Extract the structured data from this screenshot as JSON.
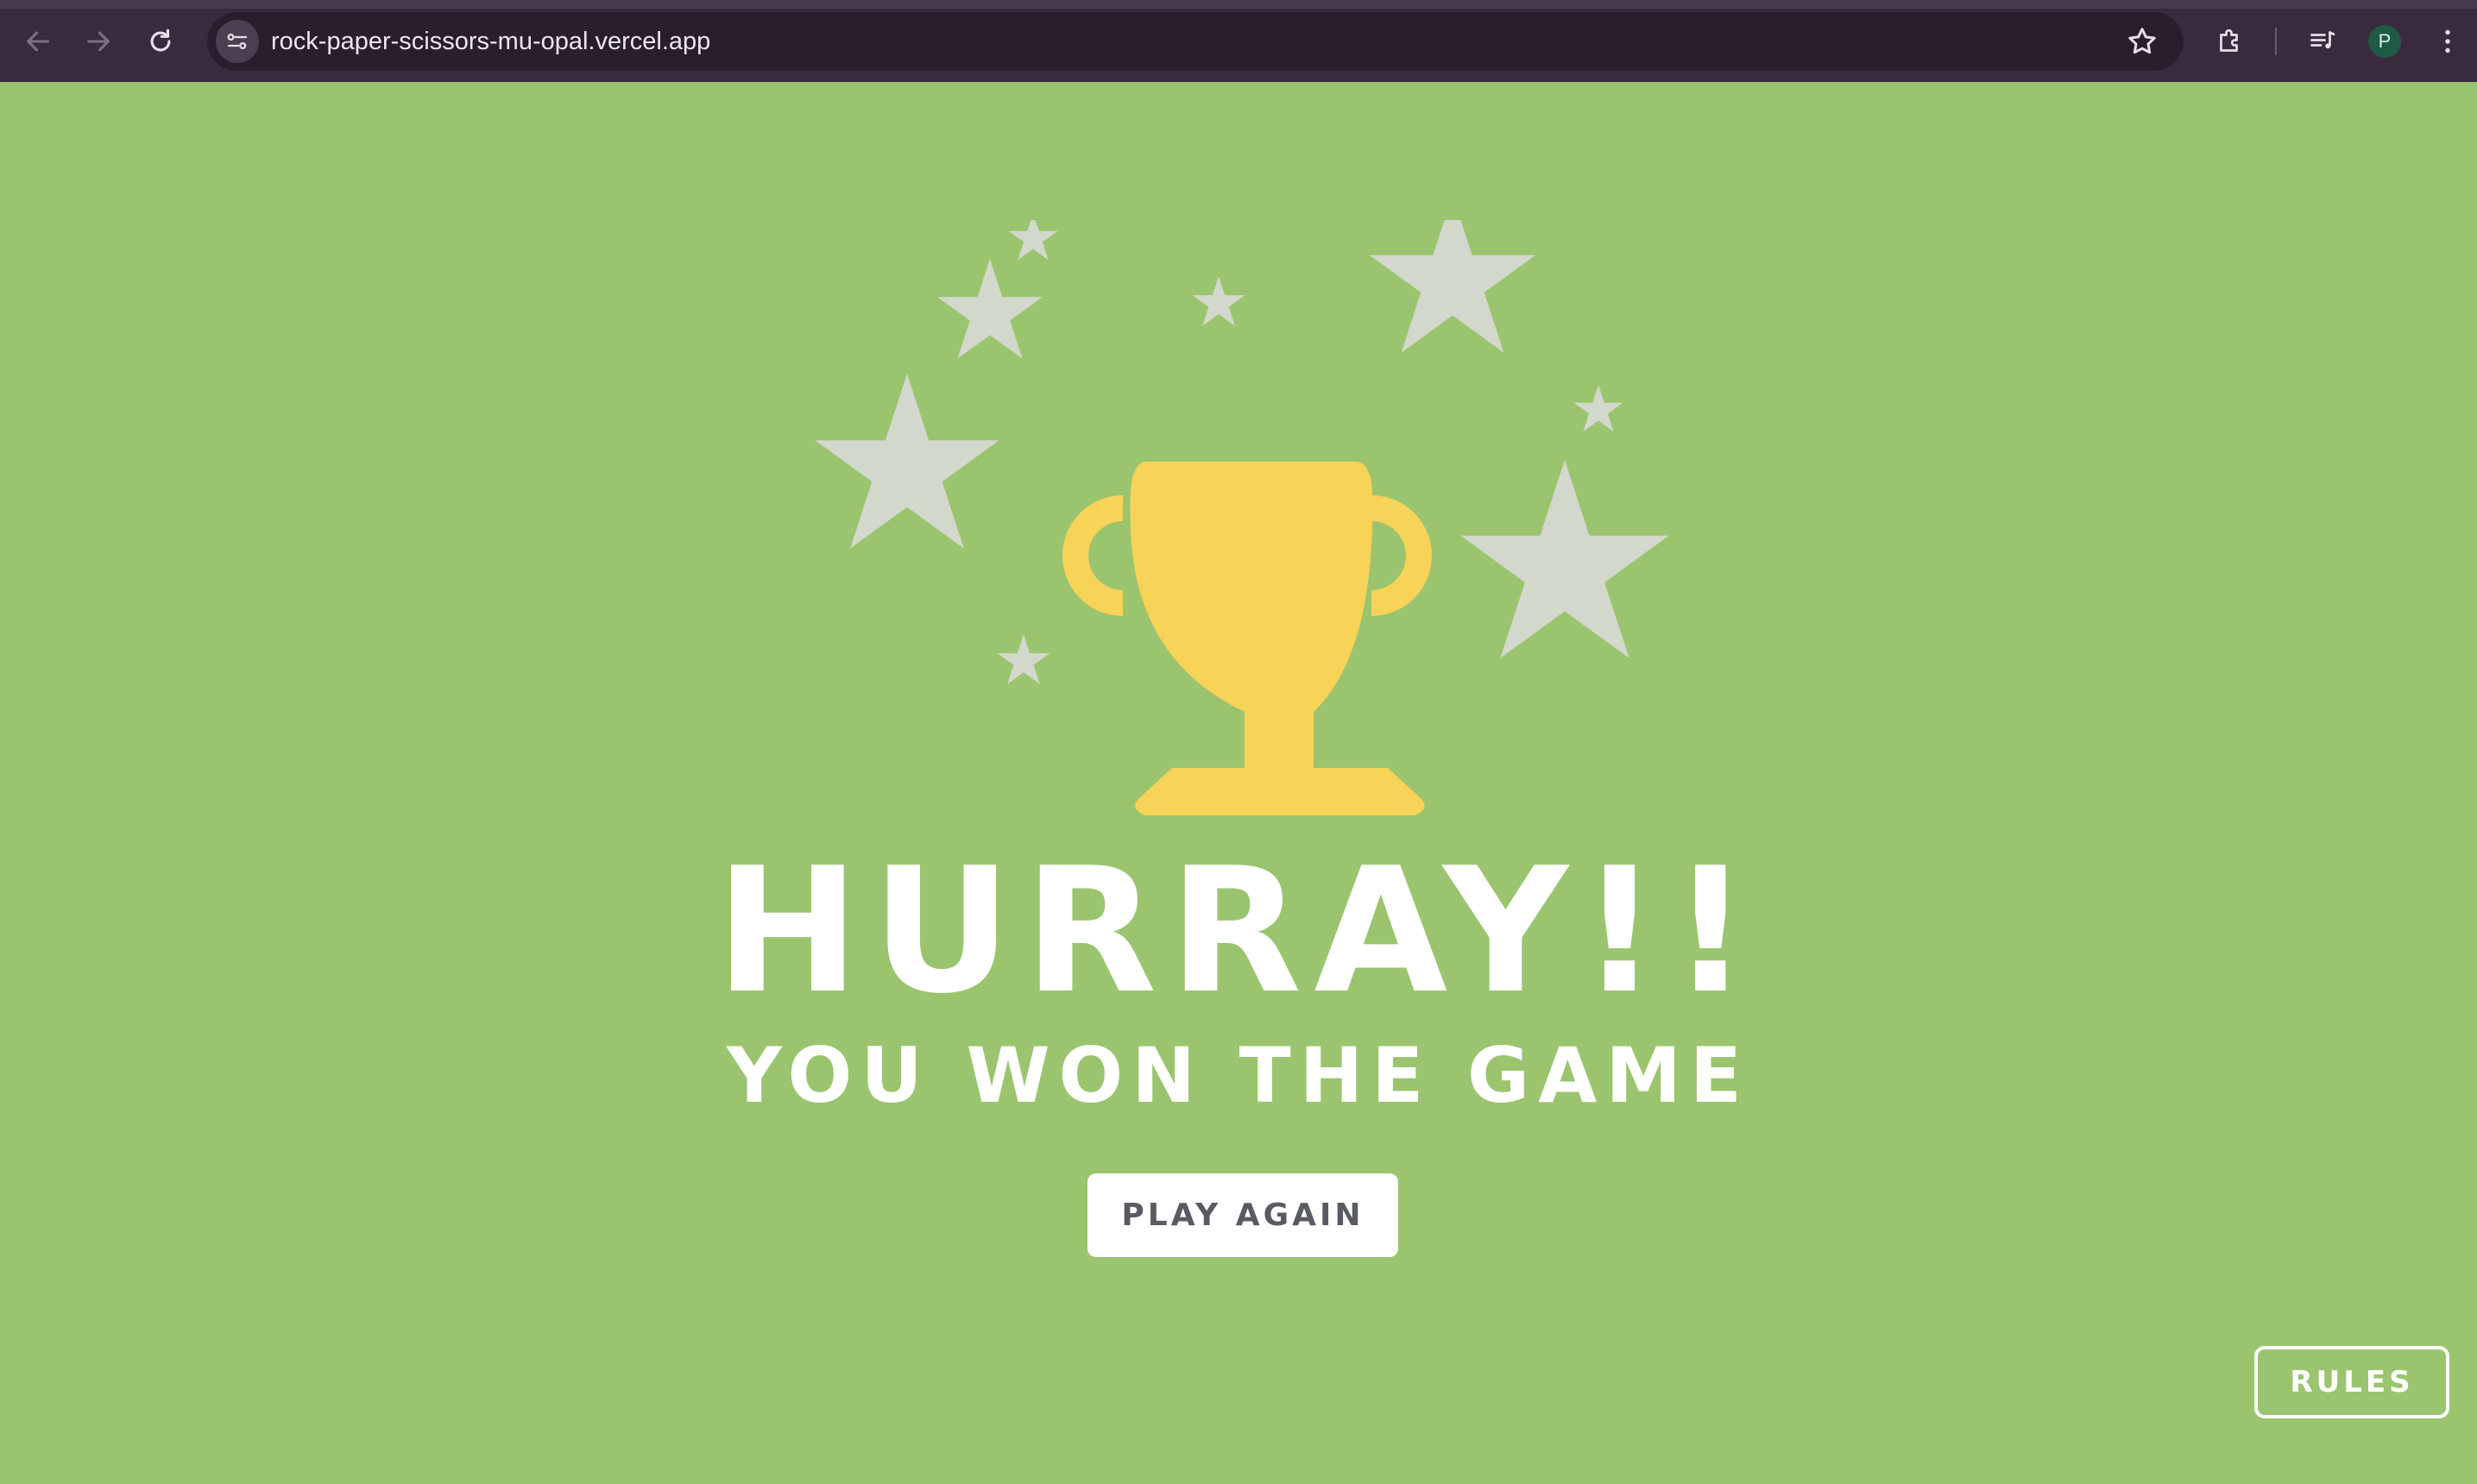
{
  "browser": {
    "url": "rock-paper-scissors-mu-opal.vercel.app",
    "profile_initial": "P",
    "icons": [
      "back-arrow-icon",
      "forward-arrow-icon",
      "reload-icon",
      "site-info-icon",
      "bookmark-star-icon",
      "extensions-icon",
      "media-controls-icon",
      "more-menu-icon"
    ]
  },
  "result": {
    "headline": "HURRAY!!",
    "subline": "YOU WON THE GAME",
    "play_again_label": "PLAY AGAIN",
    "icons": [
      "trophy-icon",
      "star-icon"
    ]
  },
  "rules_label": "RULES",
  "colors": {
    "background": "#9bc46f",
    "trophy": "#f7d358",
    "stars": "#d2d8cb",
    "text": "#ffffff",
    "chrome": "#3a2a3e"
  }
}
